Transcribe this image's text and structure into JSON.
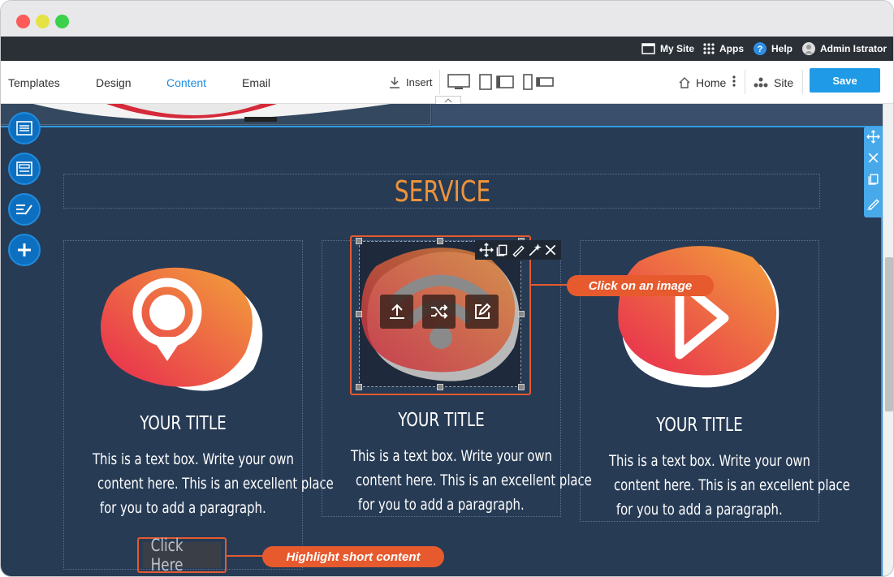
{
  "topbar": {
    "my_site": "My Site",
    "apps": "Apps",
    "help": "Help",
    "user": "Admin Istrator"
  },
  "menubar": {
    "tabs": [
      "Templates",
      "Design",
      "Content",
      "Email"
    ],
    "active_tab": "Content",
    "insert": "Insert",
    "home": "Home",
    "site": "Site",
    "save": "Save"
  },
  "colors": {
    "accent": "#1e9ae6",
    "section_bg": "#273b55",
    "title_orange": "#f0933a",
    "callout": "#e65a2e"
  },
  "left_tools": [
    "list-icon",
    "layout-icon",
    "edit-text-icon",
    "plus-icon"
  ],
  "section_tools": [
    "move-icon",
    "close-icon",
    "copy-icon",
    "edit-icon"
  ],
  "section": {
    "title": "SERVICE",
    "cards": [
      {
        "icon": "location-pin-icon",
        "title": "YOUR TITLE",
        "text_lines": [
          "This is a text box. Write your own",
          "content here. This is an excellent place",
          "for you to add a paragraph."
        ],
        "button": "Click Here"
      },
      {
        "icon": "wifi-icon",
        "title": "YOUR TITLE",
        "text_lines": [
          "This is a text box. Write your own",
          "content here. This is an excellent place",
          "for you to add a paragraph."
        ]
      },
      {
        "icon": "play-icon",
        "title": "YOUR TITLE",
        "text_lines": [
          "This is a text box. Write your own",
          "content here. This is an excellent place",
          "for you to add a paragraph."
        ]
      }
    ]
  },
  "image_toolbar": [
    "move-icon",
    "copy-icon",
    "edit-icon",
    "magic-wand-icon",
    "close-icon"
  ],
  "image_overlay": [
    "upload-icon",
    "shuffle-icon",
    "edit-icon"
  ],
  "callouts": {
    "image": "Click on an image",
    "button": "Highlight short content"
  }
}
